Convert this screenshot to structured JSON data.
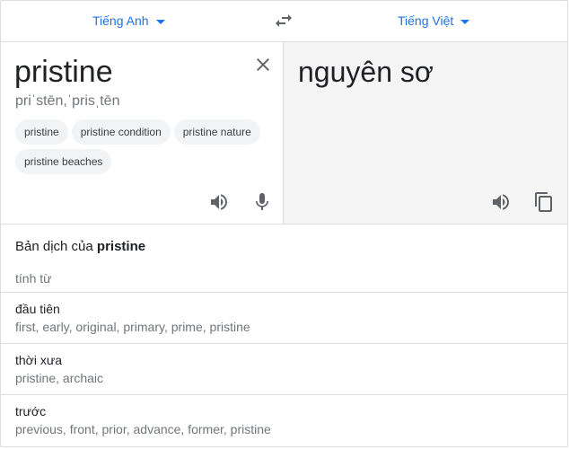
{
  "source_lang": "Tiếng Anh",
  "target_lang": "Tiếng Việt",
  "source": {
    "word": "pristine",
    "transliteration": "priˈstēn,ˈprisˌtēn",
    "suggestions": [
      "pristine",
      "pristine condition",
      "pristine nature",
      "pristine beaches"
    ]
  },
  "target": {
    "word": "nguyên sơ"
  },
  "details": {
    "heading_prefix": "Bản dịch của",
    "heading_word": "pristine",
    "part_of_speech": "tính từ",
    "entries": [
      {
        "term": "đầu tiên",
        "synonyms": "first, early, original, primary, prime, pristine"
      },
      {
        "term": "thời xưa",
        "synonyms": "pristine, archaic"
      },
      {
        "term": "trước",
        "synonyms": "previous, front, prior, advance, former, pristine"
      }
    ]
  },
  "colors": {
    "accent": "#1a73e8",
    "icon": "#5f6368",
    "border": "#dadce0",
    "target_bg": "#f5f5f5"
  },
  "icons": [
    "caret-down-icon",
    "swap-icon",
    "close-icon",
    "speaker-icon",
    "microphone-icon",
    "copy-icon"
  ]
}
